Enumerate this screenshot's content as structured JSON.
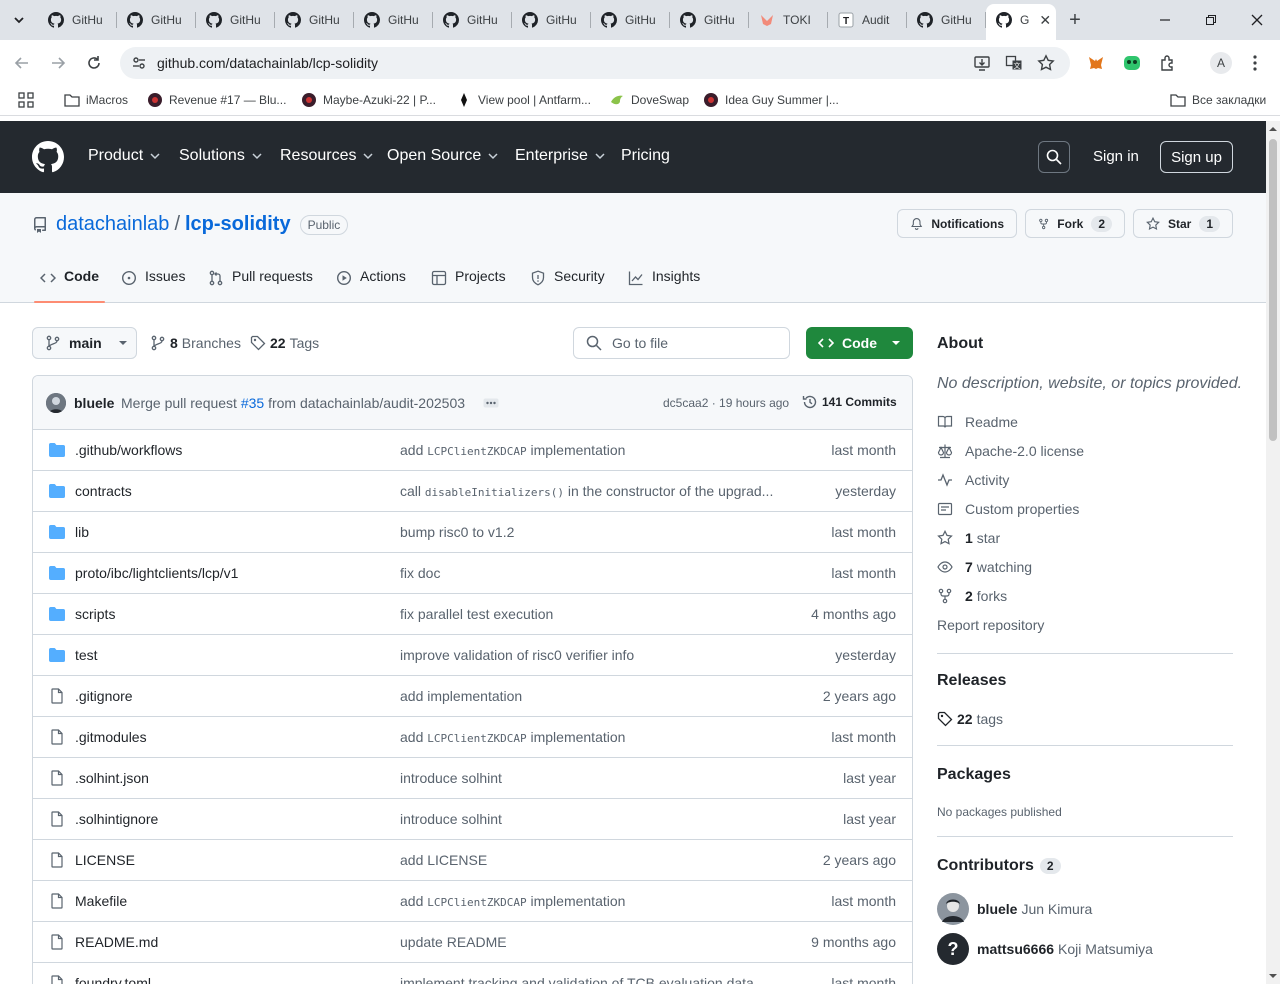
{
  "browser": {
    "tabs": [
      {
        "title": "GitHu",
        "icon": "github-icon"
      },
      {
        "title": "GitHu",
        "icon": "github-icon"
      },
      {
        "title": "GitHu",
        "icon": "github-icon"
      },
      {
        "title": "GitHu",
        "icon": "github-icon"
      },
      {
        "title": "GitHu",
        "icon": "github-icon"
      },
      {
        "title": "GitHu",
        "icon": "github-icon"
      },
      {
        "title": "GitHu",
        "icon": "github-icon"
      },
      {
        "title": "GitHu",
        "icon": "github-icon"
      },
      {
        "title": "GitHu",
        "icon": "github-icon"
      },
      {
        "title": "TOKI",
        "icon": "toki-icon"
      },
      {
        "title": "Audit",
        "icon": "t-icon"
      },
      {
        "title": "GitHu",
        "icon": "github-icon"
      },
      {
        "title": "G",
        "icon": "github-icon"
      }
    ],
    "url": "github.com/datachainlab/lcp-solidity",
    "profile_initial": "A",
    "bookmarks": [
      {
        "label": "iMacros",
        "icon": "folder-icon"
      },
      {
        "label": "Revenue #17 — Blu...",
        "icon": "site-icon"
      },
      {
        "label": "Maybe-Azuki-22 | P...",
        "icon": "site-icon"
      },
      {
        "label": "View pool | Antfarm...",
        "icon": "antfarm-icon"
      },
      {
        "label": "DoveSwap",
        "icon": "dove-icon"
      },
      {
        "label": "Idea Guy Summer |...",
        "icon": "site-icon"
      }
    ],
    "all_bookmarks": "Все закладки"
  },
  "gh_header": {
    "nav": [
      "Product",
      "Solutions",
      "Resources",
      "Open Source",
      "Enterprise",
      "Pricing"
    ],
    "sign_in": "Sign in",
    "sign_up": "Sign up"
  },
  "repo": {
    "owner": "datachainlab",
    "separator": "/",
    "name": "lcp-solidity",
    "visibility": "Public",
    "notifications": "Notifications",
    "fork_label": "Fork",
    "fork_count": "2",
    "star_label": "Star",
    "star_count": "1",
    "tabs": [
      "Code",
      "Issues",
      "Pull requests",
      "Actions",
      "Projects",
      "Security",
      "Insights"
    ]
  },
  "browser_controls": {
    "branch": "main",
    "branches_count": "8",
    "branches_label": "Branches",
    "tags_count": "22",
    "tags_label": "Tags",
    "goto_placeholder": "Go to file",
    "code_button": "Code"
  },
  "last_commit": {
    "author": "bluele",
    "message_prefix": "Merge pull request",
    "pr": "#35",
    "message_suffix": "from datachainlab/audit-202503",
    "hash_and_time": "dc5caa2 · 19 hours ago",
    "commits": "141 Commits"
  },
  "files": [
    {
      "name": ".github/workflows",
      "type": "dir",
      "msg_pre": "add",
      "msg_code": "LCPClientZKDCAP",
      "msg_post": "implementation",
      "date": "last month"
    },
    {
      "name": "contracts",
      "type": "dir",
      "msg_pre": "call",
      "msg_code": "disableInitializers()",
      "msg_post": "in the constructor of the upgrad...",
      "date": "yesterday"
    },
    {
      "name": "lib",
      "type": "dir",
      "msg_pre": "bump risc0 to v1.2",
      "msg_code": "",
      "msg_post": "",
      "date": "last month"
    },
    {
      "name": "proto/ibc/lightclients/lcp/v1",
      "type": "dir",
      "msg_pre": "fix doc",
      "msg_code": "",
      "msg_post": "",
      "date": "last month"
    },
    {
      "name": "scripts",
      "type": "dir",
      "msg_pre": "fix parallel test execution",
      "msg_code": "",
      "msg_post": "",
      "date": "4 months ago"
    },
    {
      "name": "test",
      "type": "dir",
      "msg_pre": "improve validation of risc0 verifier info",
      "msg_code": "",
      "msg_post": "",
      "date": "yesterday"
    },
    {
      "name": ".gitignore",
      "type": "file",
      "msg_pre": "add implementation",
      "msg_code": "",
      "msg_post": "",
      "date": "2 years ago"
    },
    {
      "name": ".gitmodules",
      "type": "file",
      "msg_pre": "add",
      "msg_code": "LCPClientZKDCAP",
      "msg_post": "implementation",
      "date": "last month"
    },
    {
      "name": ".solhint.json",
      "type": "file",
      "msg_pre": "introduce solhint",
      "msg_code": "",
      "msg_post": "",
      "date": "last year"
    },
    {
      "name": ".solhintignore",
      "type": "file",
      "msg_pre": "introduce solhint",
      "msg_code": "",
      "msg_post": "",
      "date": "last year"
    },
    {
      "name": "LICENSE",
      "type": "file",
      "msg_pre": "add LICENSE",
      "msg_code": "",
      "msg_post": "",
      "date": "2 years ago"
    },
    {
      "name": "Makefile",
      "type": "file",
      "msg_pre": "add",
      "msg_code": "LCPClientZKDCAP",
      "msg_post": "implementation",
      "date": "last month"
    },
    {
      "name": "README.md",
      "type": "file",
      "msg_pre": "update README",
      "msg_code": "",
      "msg_post": "",
      "date": "9 months ago"
    },
    {
      "name": "foundry.toml",
      "type": "file",
      "msg_pre": "implement tracking and validation of TCB evaluation data...",
      "msg_code": "",
      "msg_post": "",
      "date": "last month"
    }
  ],
  "about": {
    "title": "About",
    "description": "No description, website, or topics provided.",
    "items": [
      {
        "icon": "book-icon",
        "strong": "",
        "text": "Readme"
      },
      {
        "icon": "law-icon",
        "strong": "",
        "text": "Apache-2.0 license"
      },
      {
        "icon": "pulse-icon",
        "strong": "",
        "text": "Activity"
      },
      {
        "icon": "note-icon",
        "strong": "",
        "text": "Custom properties"
      },
      {
        "icon": "star-icon",
        "strong": "1",
        "text": "star"
      },
      {
        "icon": "eye-icon",
        "strong": "7",
        "text": "watching"
      },
      {
        "icon": "fork-icon",
        "strong": "2",
        "text": "forks"
      }
    ],
    "report": "Report repository"
  },
  "releases": {
    "title": "Releases",
    "tags_count": "22",
    "tags_label": "tags"
  },
  "packages": {
    "title": "Packages",
    "empty": "No packages published"
  },
  "contributors": {
    "title": "Contributors",
    "count": "2",
    "people": [
      {
        "login": "bluele",
        "name": "Jun Kimura"
      },
      {
        "login": "mattsu6666",
        "name": "Koji Matsumiya"
      }
    ]
  },
  "colors": {
    "gh_dark": "#24292f",
    "link": "#0969da",
    "green": "#1f883d",
    "folder": "#54aeff",
    "tab_underline": "#fd8c73"
  }
}
